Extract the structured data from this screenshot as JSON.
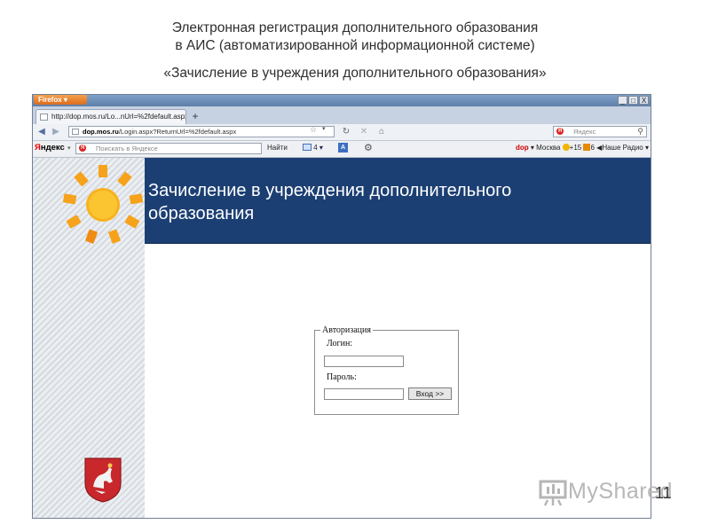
{
  "slide": {
    "title_line1": "Электронная регистрация дополнительного образования",
    "title_line2": "в АИС (автоматизированной  информационной системе)",
    "subtitle": "«Зачисление в учреждения дополнительного образования»",
    "page_number": "11",
    "watermark": "MyShared"
  },
  "browser": {
    "menu_button": "Firefox",
    "tab_title": "http://dop.mos.ru/Lo...nUrl=%2fdefault.aspx",
    "new_tab_symbol": "+",
    "url_domain": "dop.mos.ru",
    "url_path": "/Login.aspx?ReturnUrl=%2fdefault.aspx",
    "search_placeholder": "Яндекс",
    "controls": {
      "minimize": "_",
      "maximize": "□",
      "close": "X"
    }
  },
  "yandex_bar": {
    "logo_first": "Я",
    "logo_rest": "ндекс",
    "search_placeholder": "Поискать в Яндексе",
    "find_button": "Найти",
    "mail_count": "4",
    "region_brand": "dop",
    "city": "Москва",
    "weather": "+15",
    "traffic": "6",
    "radio": "Наше Радио"
  },
  "page": {
    "header_title": "Зачисление в учреждения дополнительного образования",
    "auth": {
      "legend": "Авторизация",
      "login_label": "Логин:",
      "password_label": "Пароль:",
      "login_value": "",
      "password_value": "",
      "submit_label": "Вход >>"
    }
  },
  "colors": {
    "header_band": "#1c3f73",
    "sun": "#f6a21b"
  }
}
